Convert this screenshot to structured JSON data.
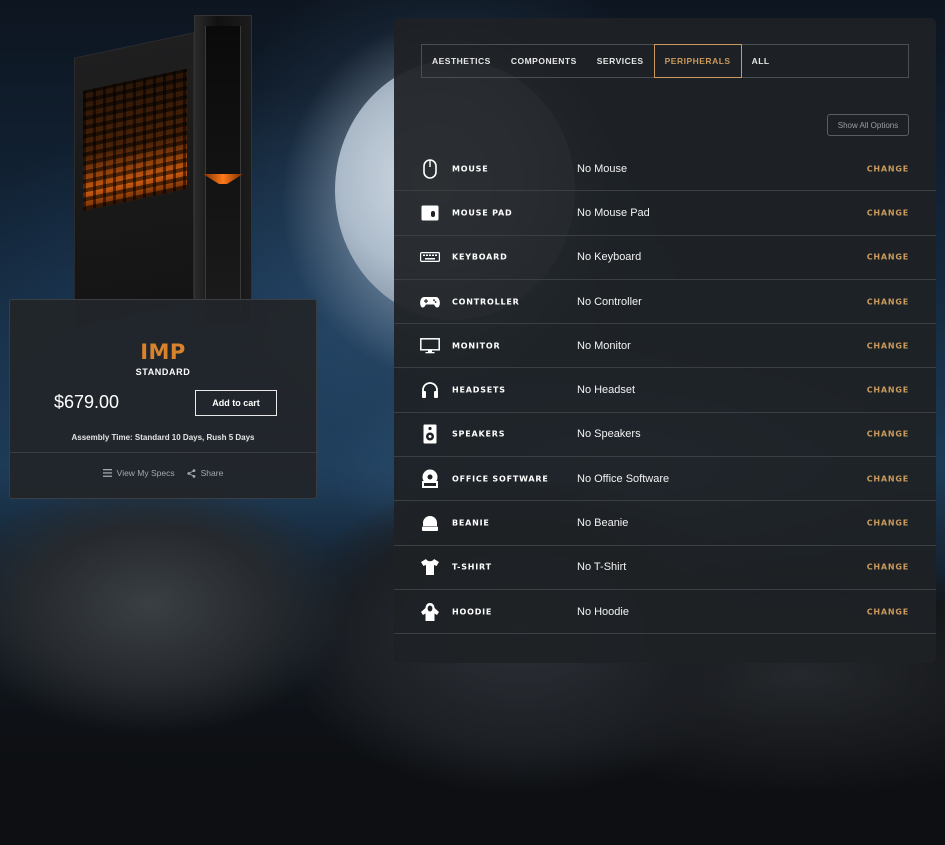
{
  "accent_color": "#c99a5b",
  "product": {
    "name": "IMP",
    "tier": "STANDARD",
    "price": "$679.00",
    "add_to_cart": "Add to cart",
    "assembly": "Assembly Time: Standard 10 Days, Rush 5 Days",
    "view_specs": "View My Specs",
    "share": "Share"
  },
  "tabs": [
    {
      "label": "AESTHETICS",
      "active": false
    },
    {
      "label": "COMPONENTS",
      "active": false
    },
    {
      "label": "SERVICES",
      "active": false
    },
    {
      "label": "PERIPHERALS",
      "active": true
    },
    {
      "label": "ALL",
      "active": false
    }
  ],
  "show_all": "Show All Options",
  "change_label": "CHANGE",
  "options": [
    {
      "name": "MOUSE",
      "value": "No Mouse",
      "icon": "mouse-icon"
    },
    {
      "name": "MOUSE PAD",
      "value": "No Mouse Pad",
      "icon": "mouse-pad-icon"
    },
    {
      "name": "KEYBOARD",
      "value": "No Keyboard",
      "icon": "keyboard-icon"
    },
    {
      "name": "CONTROLLER",
      "value": "No Controller",
      "icon": "controller-icon"
    },
    {
      "name": "MONITOR",
      "value": "No Monitor",
      "icon": "monitor-icon"
    },
    {
      "name": "HEADSETS",
      "value": "No Headset",
      "icon": "headset-icon"
    },
    {
      "name": "SPEAKERS",
      "value": "No Speakers",
      "icon": "speaker-icon"
    },
    {
      "name": "OFFICE SOFTWARE",
      "value": "No Office Software",
      "icon": "software-disc-icon"
    },
    {
      "name": "BEANIE",
      "value": "No Beanie",
      "icon": "beanie-icon"
    },
    {
      "name": "T-SHIRT",
      "value": "No T-Shirt",
      "icon": "tshirt-icon"
    },
    {
      "name": "HOODIE",
      "value": "No Hoodie",
      "icon": "hoodie-icon"
    }
  ]
}
